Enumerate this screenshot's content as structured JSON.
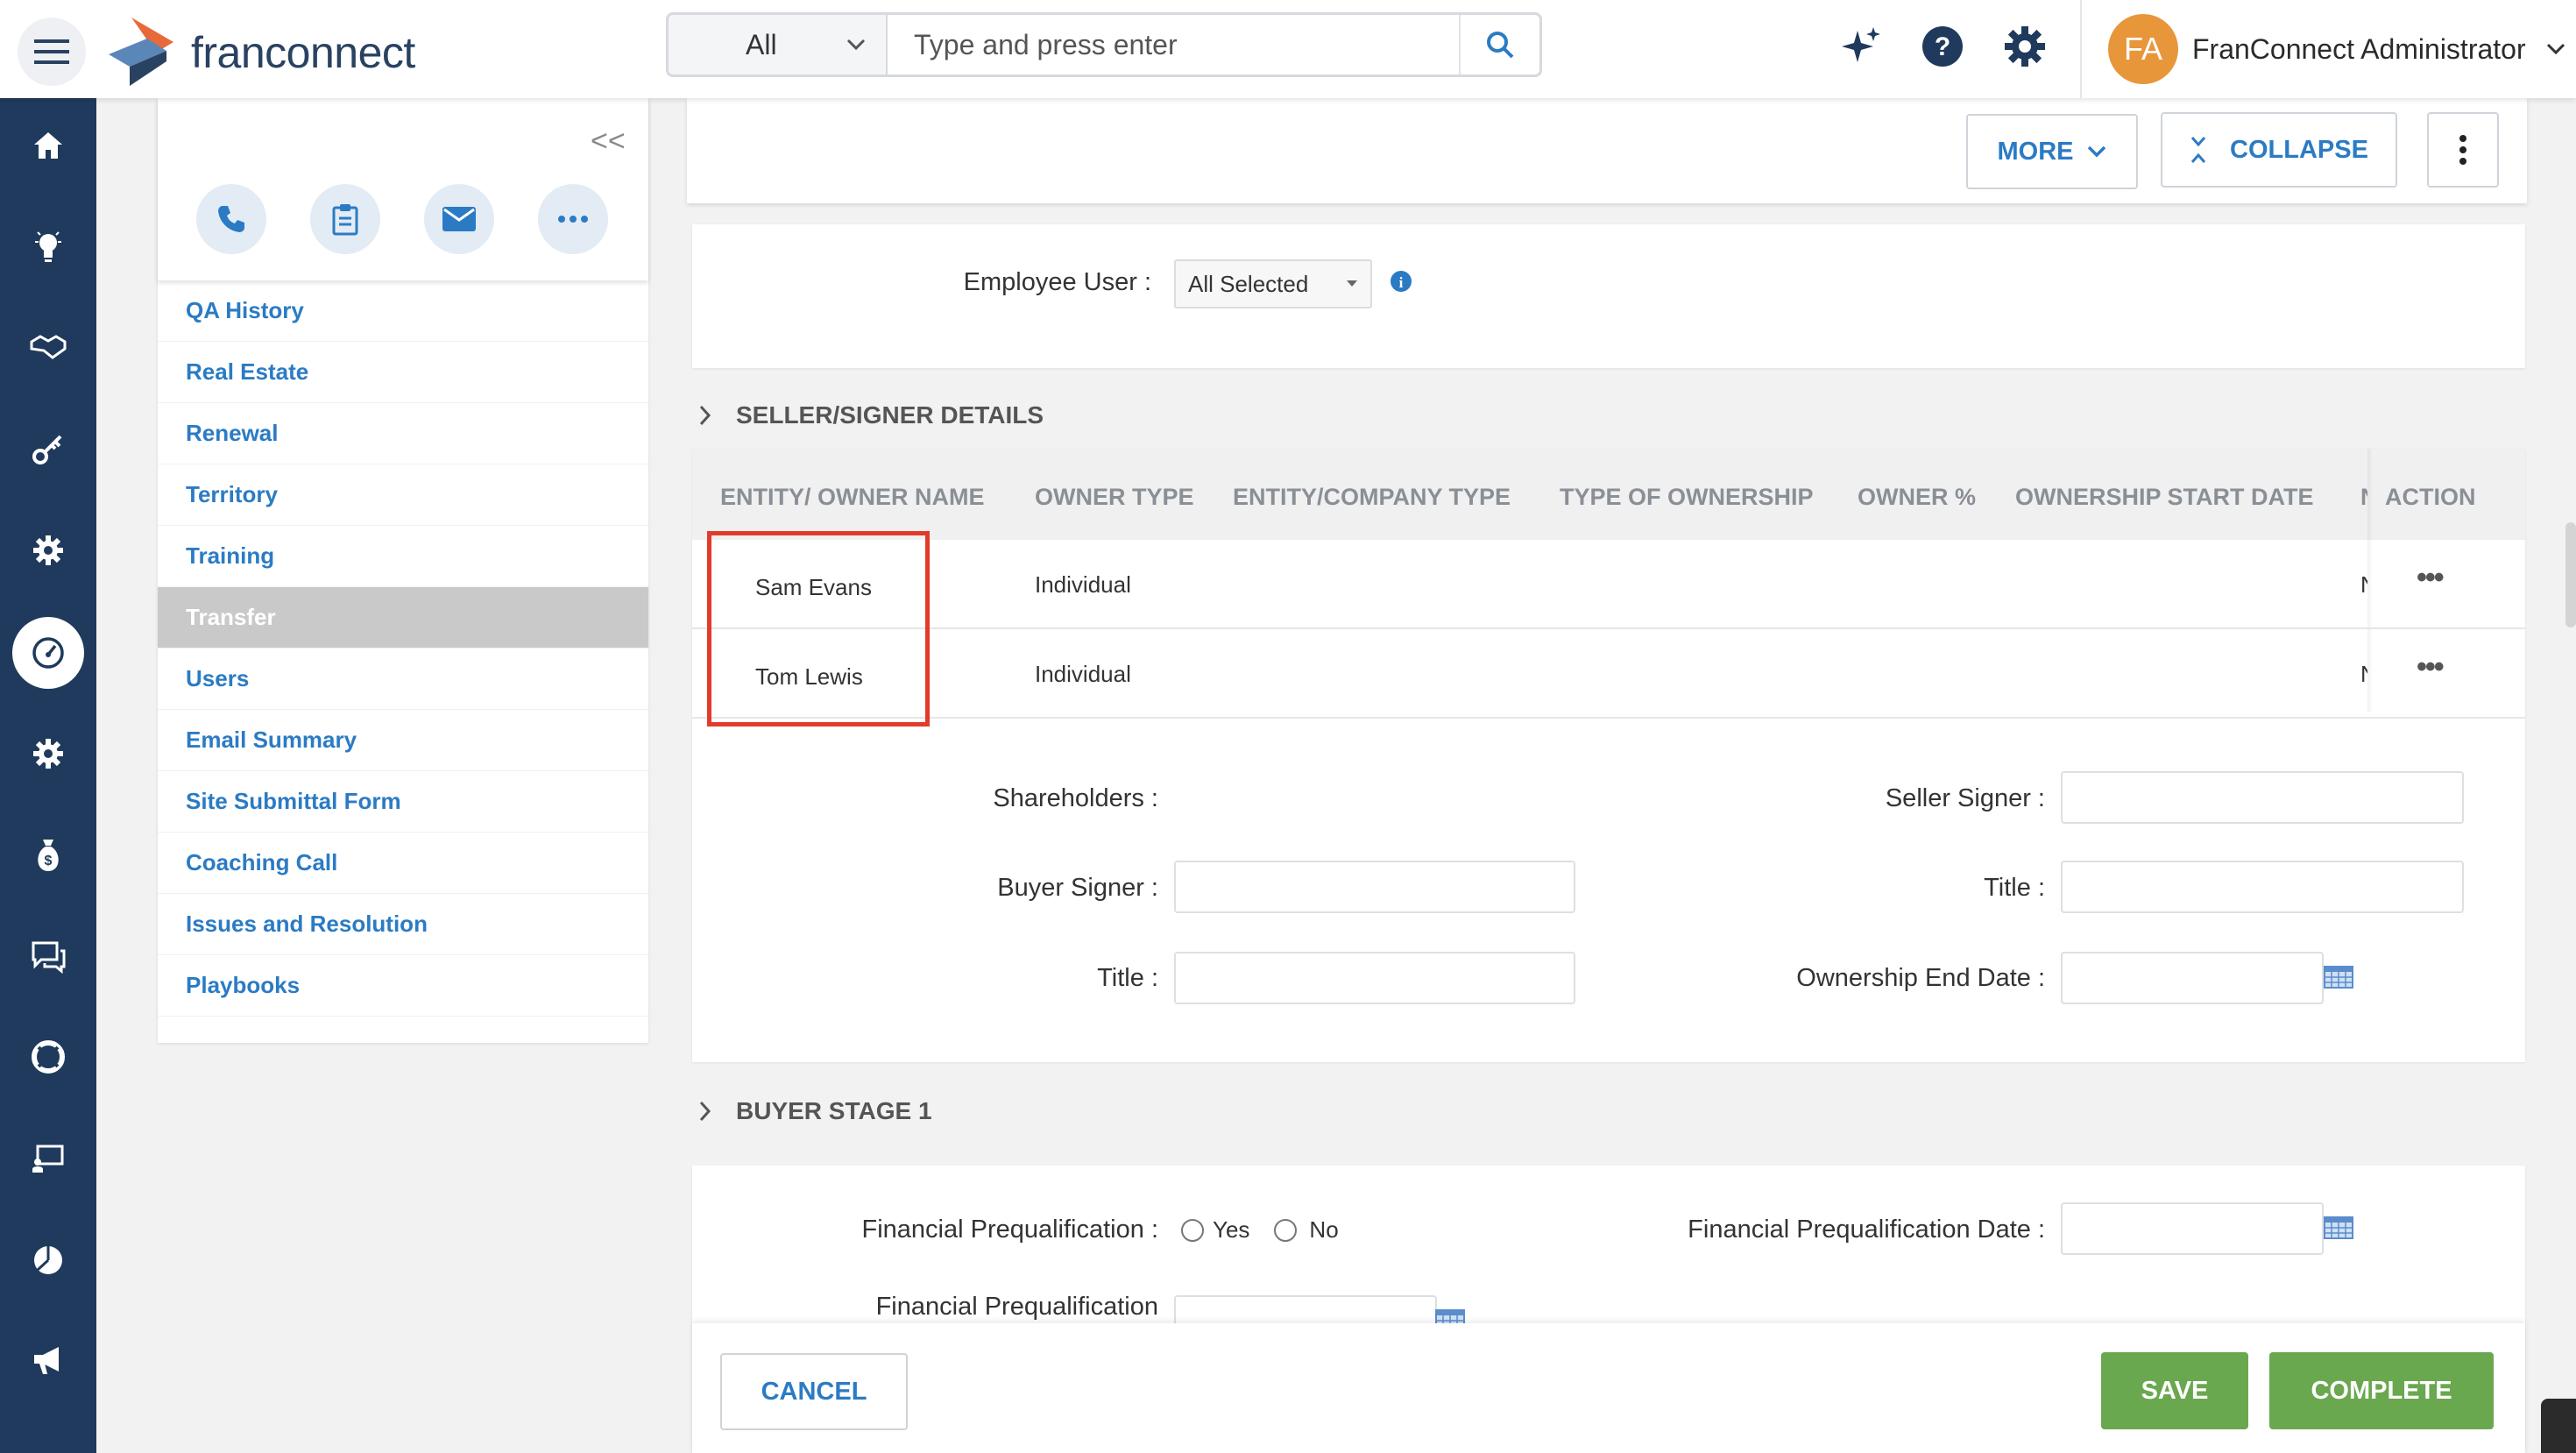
{
  "header": {
    "logo_text": "franconnect",
    "search_scope": "All",
    "search_placeholder": "Type and press enter",
    "user_initials": "FA",
    "user_name": "FranConnect Administrator"
  },
  "quick_actions": [
    "phone-icon",
    "clipboard-icon",
    "mail-icon",
    "more-icon"
  ],
  "sidebar": {
    "items": [
      {
        "label": "QA History"
      },
      {
        "label": "Real Estate"
      },
      {
        "label": "Renewal"
      },
      {
        "label": "Territory"
      },
      {
        "label": "Training"
      },
      {
        "label": "Transfer"
      },
      {
        "label": "Users"
      },
      {
        "label": "Email Summary"
      },
      {
        "label": "Site Submittal Form"
      },
      {
        "label": "Coaching Call"
      },
      {
        "label": "Issues and Resolution"
      },
      {
        "label": "Playbooks"
      }
    ],
    "active": "Transfer"
  },
  "toolbar": {
    "more_label": "MORE",
    "collapse_label": "COLLAPSE"
  },
  "employee_user": {
    "label": "Employee User :",
    "value": "All Selected"
  },
  "seller_section": {
    "title": "SELLER/SIGNER DETAILS",
    "columns": [
      "ENTITY/ OWNER NAME",
      "OWNER TYPE",
      "ENTITY/COMPANY TYPE",
      "TYPE OF OWNERSHIP",
      "OWNER %",
      "OWNERSHIP START DATE",
      "N",
      "ACTION"
    ],
    "rows": [
      {
        "name": "Sam Evans",
        "owner_type": "Individual",
        "trunc": "N"
      },
      {
        "name": "Tom Lewis",
        "owner_type": "Individual",
        "trunc": "N"
      }
    ],
    "shareholders_label": "Shareholders :",
    "seller_signer_label": "Seller Signer :",
    "buyer_signer_label": "Buyer Signer :",
    "title_label": "Title :",
    "title_label_2": "Title :",
    "ownership_end_date_label": "Ownership End Date :"
  },
  "buyer_section": {
    "title": "BUYER STAGE 1",
    "fin_prequal_label": "Financial Prequalification :",
    "yes_label": "Yes",
    "no_label": "No",
    "fin_prequal_date_label": "Financial Prequalification Date :",
    "fin_prequal_partial_label": "Financial Prequalification"
  },
  "footer": {
    "cancel_label": "CANCEL",
    "save_label": "SAVE",
    "complete_label": "COMPLETE"
  },
  "colors": {
    "rail": "#1f3a5c",
    "link": "#2b7bc4",
    "save": "#6aa84f",
    "highlight": "#e23b2b",
    "avatar": "#e8963a"
  }
}
